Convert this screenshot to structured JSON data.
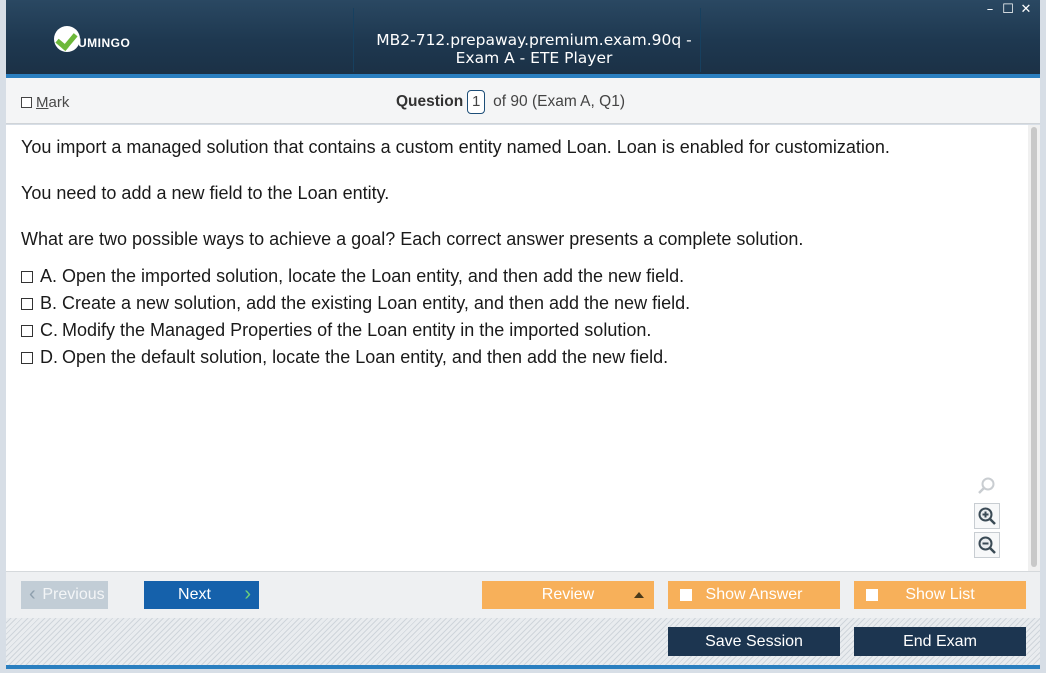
{
  "app": {
    "logo_text": "UMINGO",
    "window_title": "MB2-712.prepaway.premium.exam.90q - Exam A - ETE Player",
    "controls": {
      "minimize": "–",
      "maximize": "☐",
      "close": "✕"
    }
  },
  "header": {
    "mark_label": "Mark",
    "question_word": "Question",
    "question_number": "1",
    "question_suffix": "of 90 (Exam A, Q1)"
  },
  "question": {
    "paragraphs": [
      "You import a managed solution that contains a custom entity named Loan. Loan is enabled for customization.",
      "You need to add a new field to the Loan entity.",
      "What are two possible ways to achieve a goal? Each correct answer presents a complete solution."
    ],
    "options": [
      {
        "letter": "A.",
        "text": "Open the imported solution, locate the Loan entity, and then add the new field."
      },
      {
        "letter": "B.",
        "text": "Create a new solution, add the existing Loan entity, and then add the new field."
      },
      {
        "letter": "C.",
        "text": "Modify the Managed Properties of the Loan entity in the imported solution."
      },
      {
        "letter": "D.",
        "text": "Open the default solution, locate the Loan entity, and then add the new field."
      }
    ]
  },
  "nav": {
    "previous": "Previous",
    "next": "Next",
    "review": "Review",
    "show_answer": "Show Answer",
    "show_list": "Show List",
    "save_session": "Save Session",
    "end_exam": "End Exam"
  },
  "icons": {
    "zoom_reset": "magnifier-icon",
    "zoom_in": "zoom-in-icon",
    "zoom_out": "zoom-out-icon"
  },
  "colors": {
    "titlebar": "#1e3850",
    "accent_blue": "#2a7fc0",
    "next_button": "#1561ab",
    "orange_button": "#f7b05a",
    "dark_button": "#1c3550",
    "logo_green": "#6db83a"
  }
}
